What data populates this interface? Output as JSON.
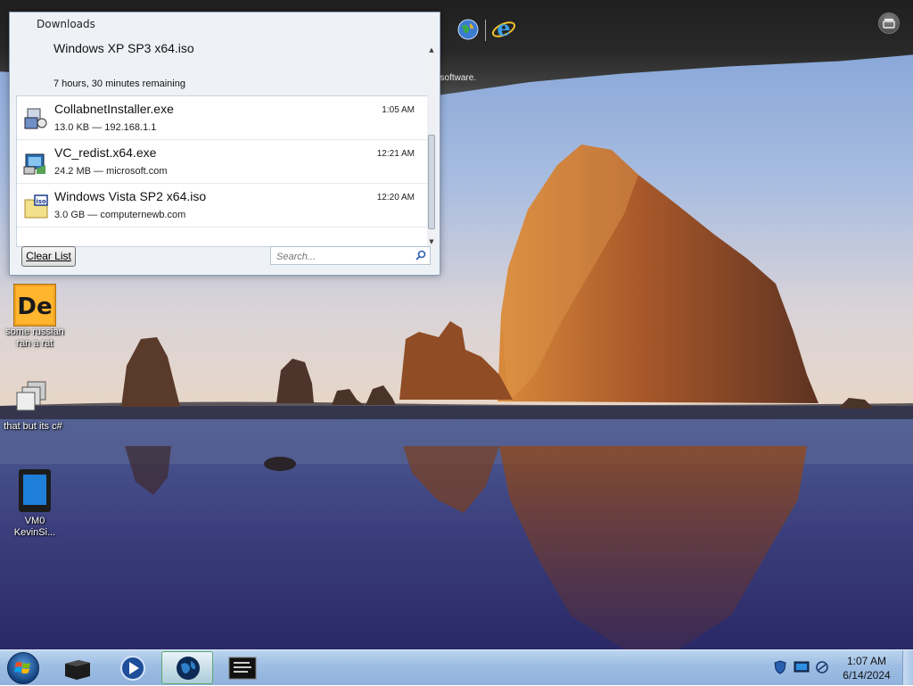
{
  "launcher": {
    "caption": "Find your favourite software.",
    "icons": [
      "software-store-icon",
      "globe-icon",
      "ie-icon"
    ]
  },
  "downloads": {
    "window_title": "Downloads",
    "top_item_partial": {
      "name": "Windows XP SP3 x64.iso",
      "status": "7 hours, 30 minutes remaining"
    },
    "items": [
      {
        "name": "CollabnetInstaller.exe",
        "meta": "13.0 KB — 192.168.1.1",
        "time": "1:05 AM",
        "icon": "installer-icon"
      },
      {
        "name": "VC_redist.x64.exe",
        "meta": "24.2 MB — microsoft.com",
        "time": "12:21 AM",
        "icon": "setup-icon"
      },
      {
        "name": "Windows Vista SP2 x64.iso",
        "meta": "3.0 GB — computernewb.com",
        "time": "12:20 AM",
        "icon": "iso-file-icon"
      }
    ],
    "clear_label": "Clear List",
    "search_placeholder": "Search..."
  },
  "desktop": {
    "icons": [
      {
        "label": "some russian ran a rat",
        "icon": "de-app-icon"
      },
      {
        "label": "that but its c#",
        "icon": "stacked-windows-icon"
      },
      {
        "label": "VM0 KevinSi...",
        "icon": "tablet-icon"
      }
    ]
  },
  "taskbar": {
    "buttons": [
      "explorer-icon",
      "media-player-icon",
      "browser-globe-icon",
      "console-icon"
    ],
    "active_button": "browser-globe-icon",
    "tray_icons": [
      "shield-icon",
      "monitor-icon",
      "network-icon"
    ],
    "clock_time": "1:07 AM",
    "clock_date": "6/14/2024"
  },
  "colors": {
    "taskbar": "#9dbde3",
    "sky": "#9fb7dc",
    "rock": "#b0622a",
    "window_bg": "#eef2f7"
  }
}
